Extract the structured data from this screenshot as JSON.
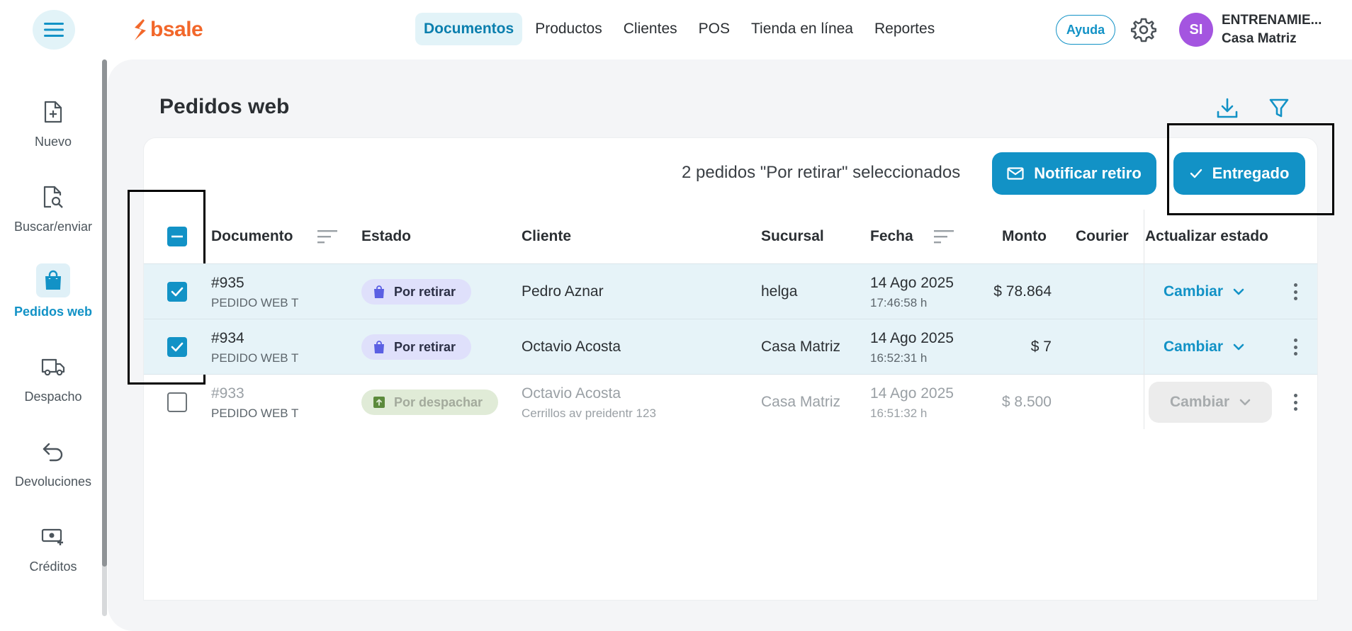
{
  "header": {
    "logo_text": "bsale",
    "nav": [
      "Documentos",
      "Productos",
      "Clientes",
      "POS",
      "Tienda en línea",
      "Reportes"
    ],
    "active_nav": "Documentos",
    "help_label": "Ayuda",
    "avatar_initials": "SI",
    "account_name": "ENTRENAMIE...",
    "branch_name": "Casa Matriz"
  },
  "sidebar": {
    "items": [
      {
        "label": "Nuevo",
        "icon": "file-plus-icon"
      },
      {
        "label": "Buscar/enviar",
        "icon": "file-search-icon"
      },
      {
        "label": "Pedidos web",
        "icon": "shopping-bag-icon"
      },
      {
        "label": "Despacho",
        "icon": "truck-icon"
      },
      {
        "label": "Devoluciones",
        "icon": "return-arrow-icon"
      },
      {
        "label": "Créditos",
        "icon": "cash-icon"
      }
    ],
    "active": "Pedidos web"
  },
  "page": {
    "title": "Pedidos web",
    "selection_text": "2 pedidos \"Por retirar\" seleccionados",
    "notify_label": "Notificar retiro",
    "delivered_label": "Entregado"
  },
  "table": {
    "headers": {
      "documento": "Documento",
      "estado": "Estado",
      "cliente": "Cliente",
      "sucursal": "Sucursal",
      "fecha": "Fecha",
      "monto": "Monto",
      "courier": "Courier",
      "actualizar": "Actualizar estado"
    },
    "rows": [
      {
        "doc": "#935",
        "doc_type": "PEDIDO WEB T",
        "status": "Por retirar",
        "client": "Pedro Aznar",
        "client_sub": "",
        "branch": "helga",
        "date": "14 Ago 2025",
        "time": "17:46:58 h",
        "amount": "$ 78.864",
        "courier": "",
        "action": "Cambiar",
        "checked": true
      },
      {
        "doc": "#934",
        "doc_type": "PEDIDO WEB T",
        "status": "Por retirar",
        "client": "Octavio Acosta",
        "client_sub": "",
        "branch": "Casa Matriz",
        "date": "14 Ago 2025",
        "time": "16:52:31 h",
        "amount": "$ 7",
        "courier": "",
        "action": "Cambiar",
        "checked": true
      },
      {
        "doc": "#933",
        "doc_type": "PEDIDO WEB T",
        "status": "Por despachar",
        "client": "Octavio Acosta",
        "client_sub": "Cerrillos av preidentr 123",
        "branch": "Casa Matriz",
        "date": "14 Ago 2025",
        "time": "16:51:32 h",
        "amount": "$ 8.500",
        "courier": "",
        "action": "Cambiar",
        "checked": false
      }
    ]
  },
  "colors": {
    "accent": "#1292c6",
    "brand": "#f2672a",
    "avatar": "#a455e0",
    "selected_row": "#e6f3f8"
  }
}
